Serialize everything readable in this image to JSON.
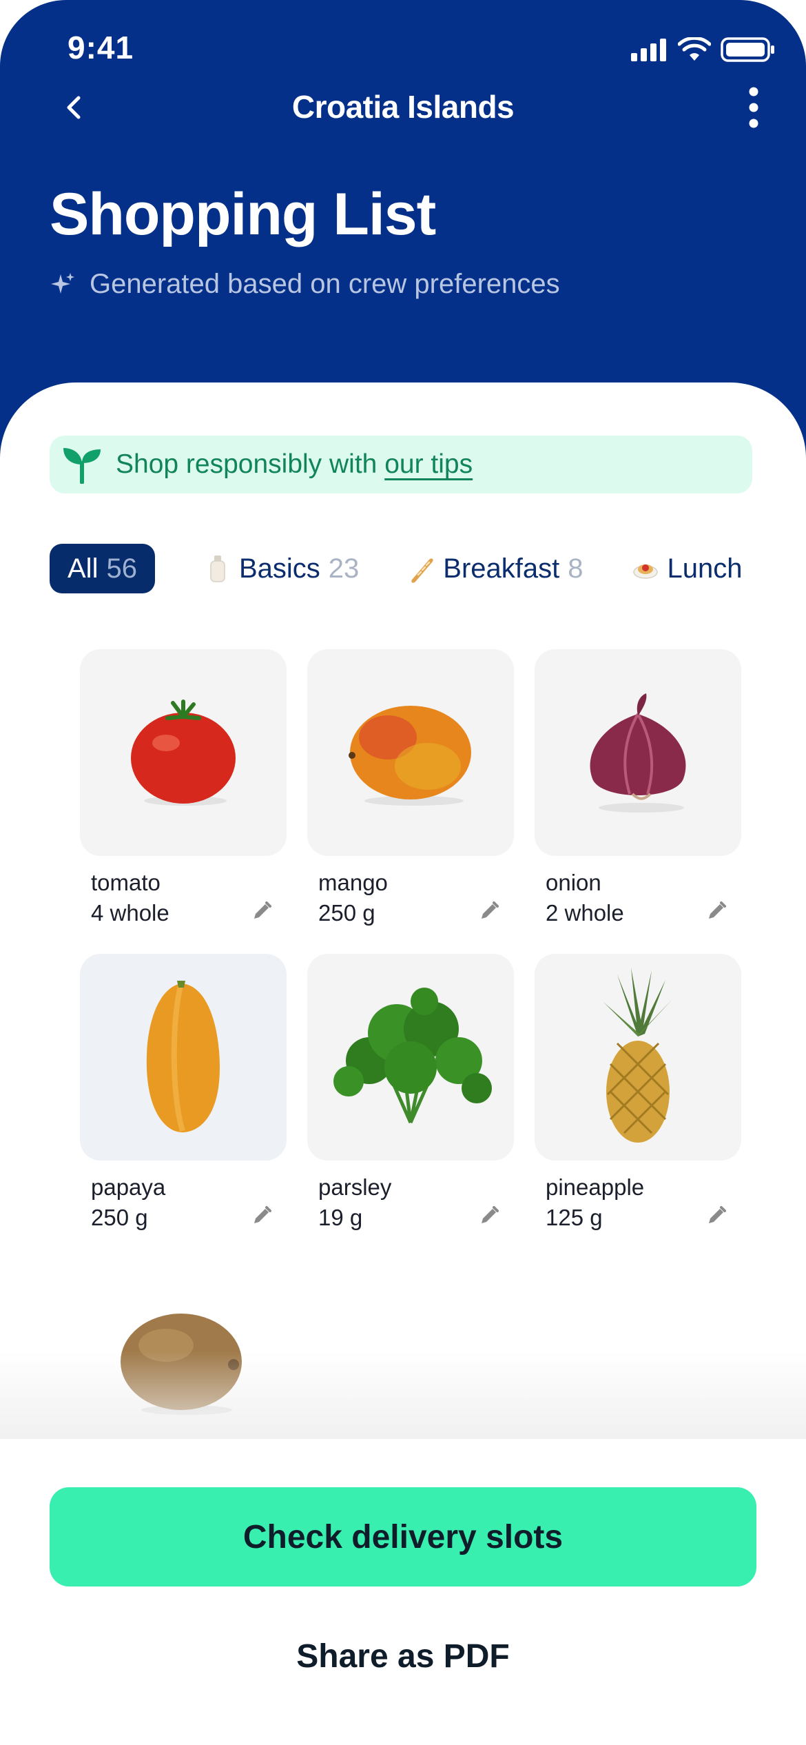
{
  "status_bar": {
    "time": "9:41"
  },
  "nav": {
    "title": "Croatia Islands"
  },
  "header": {
    "title": "Shopping List",
    "subtitle": "Generated based on crew preferences"
  },
  "tip": {
    "text": "Shop responsibly with ",
    "link": "our tips"
  },
  "categories": [
    {
      "label": "All",
      "count": "56",
      "active": true
    },
    {
      "label": "Basics",
      "count": "23"
    },
    {
      "label": "Breakfast",
      "count": "8"
    },
    {
      "label": "Lunch",
      "count": ""
    }
  ],
  "items": [
    {
      "name": "tomato",
      "qty": "4 whole"
    },
    {
      "name": "mango",
      "qty": "250 g"
    },
    {
      "name": "onion",
      "qty": "2 whole"
    },
    {
      "name": "papaya",
      "qty": "250 g"
    },
    {
      "name": "parsley",
      "qty": "19 g"
    },
    {
      "name": "pineapple",
      "qty": "125 g"
    }
  ],
  "actions": {
    "primary": "Check delivery slots",
    "secondary": "Share as PDF"
  },
  "colors": {
    "header_bg": "#053089",
    "accent_green": "#38efaf",
    "tip_bg": "#dcfbee",
    "tip_text": "#12845a",
    "chip_active_bg": "#062c6c"
  }
}
